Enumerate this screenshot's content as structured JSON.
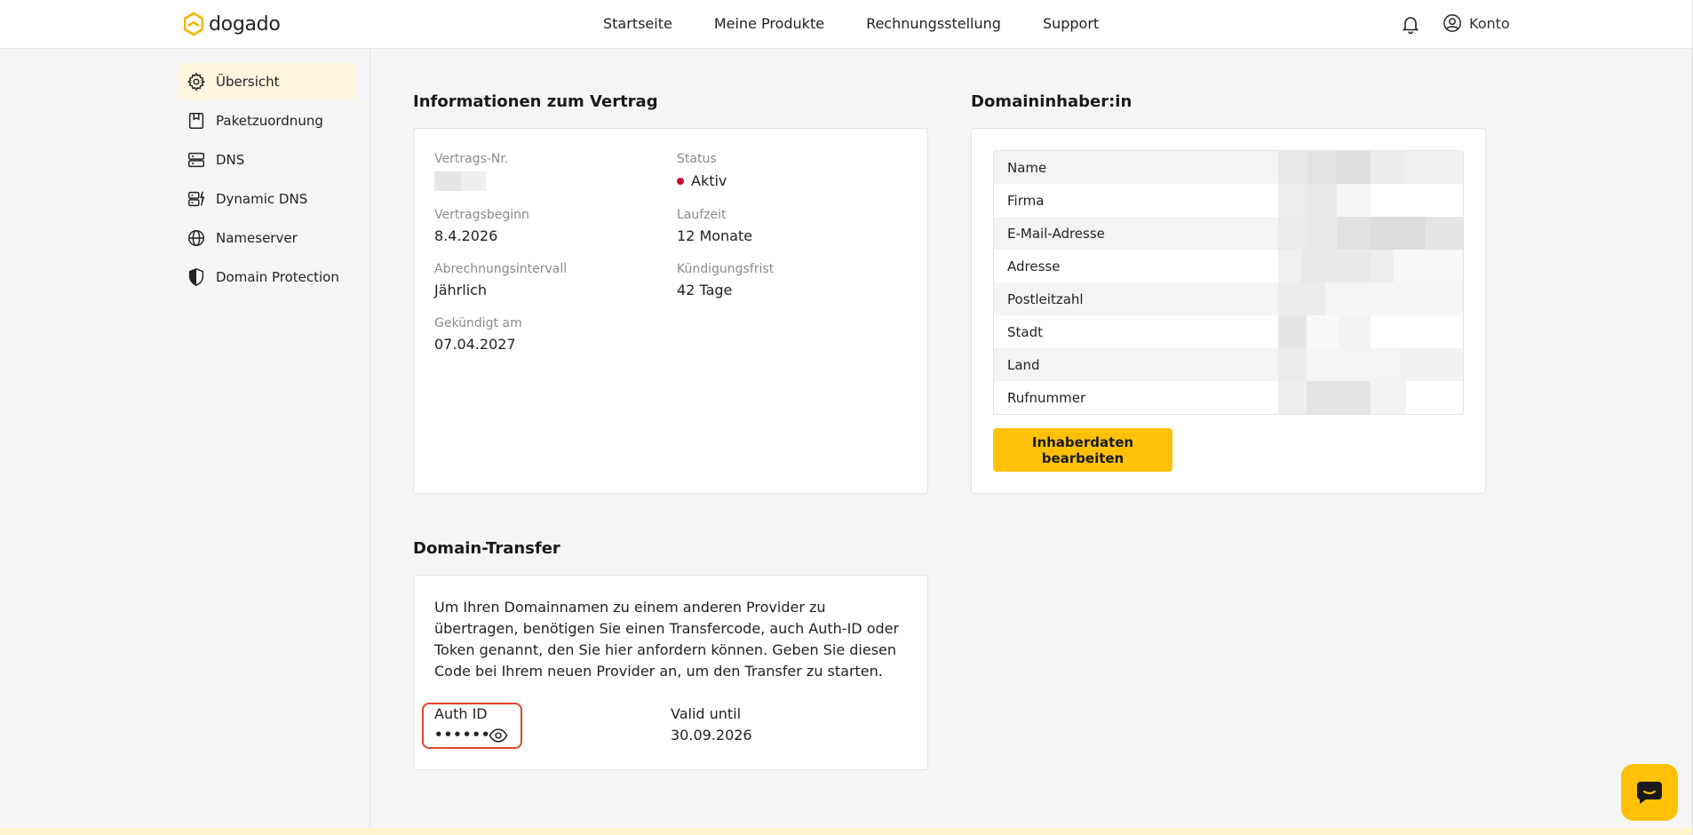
{
  "brand": {
    "name": "dogado",
    "accent": "#ffc107",
    "logo_color": "#f5b400"
  },
  "nav": {
    "items": [
      "Startseite",
      "Meine Produkte",
      "Rechnungsstellung",
      "Support"
    ],
    "account_label": "Konto"
  },
  "sidebar": {
    "items": [
      {
        "label": "Übersicht",
        "icon": "gear-icon",
        "active": true
      },
      {
        "label": "Paketzuordnung",
        "icon": "package-icon",
        "active": false
      },
      {
        "label": "DNS",
        "icon": "server-icon",
        "active": false
      },
      {
        "label": "Dynamic DNS",
        "icon": "dynamic-dns-icon",
        "active": false
      },
      {
        "label": "Nameserver",
        "icon": "globe-icon",
        "active": false
      },
      {
        "label": "Domain Protection",
        "icon": "shield-icon",
        "active": false
      }
    ]
  },
  "contract": {
    "title": "Informationen zum Vertrag",
    "fields": {
      "vertragsnr_label": "Vertrags-Nr.",
      "status_label": "Status",
      "status_value": "Aktiv",
      "beginn_label": "Vertragsbeginn",
      "beginn_value": "8.4.2026",
      "laufzeit_label": "Laufzeit",
      "laufzeit_value": "12 Monate",
      "intervall_label": "Abrechnungsintervall",
      "intervall_value": "Jährlich",
      "frist_label": "Kündigungsfrist",
      "frist_value": "42 Tage",
      "gekuendigt_label": "Gekündigt am",
      "gekuendigt_value": "07.04.2027"
    },
    "status_color": "#c8102e"
  },
  "owner": {
    "title": "Domaininhaber:in",
    "rows": [
      "Name",
      "Firma",
      "E-Mail-Adresse",
      "Adresse",
      "Postleitzahl",
      "Stadt",
      "Land",
      "Rufnummer"
    ],
    "edit_button": "Inhaberdaten bearbeiten"
  },
  "transfer": {
    "title": "Domain-Transfer",
    "description": "Um Ihren Domainnamen zu einem anderen Provider zu übertragen, benötigen Sie einen Transfercode, auch Auth-ID oder Token genannt, den Sie hier anfordern können. Geben Sie diesen Code bei Ihrem neuen Provider an, um den Transfer zu starten.",
    "auth_label": "Auth ID",
    "auth_masked": "••••••",
    "valid_label": "Valid until",
    "valid_value": "30.09.2026"
  }
}
